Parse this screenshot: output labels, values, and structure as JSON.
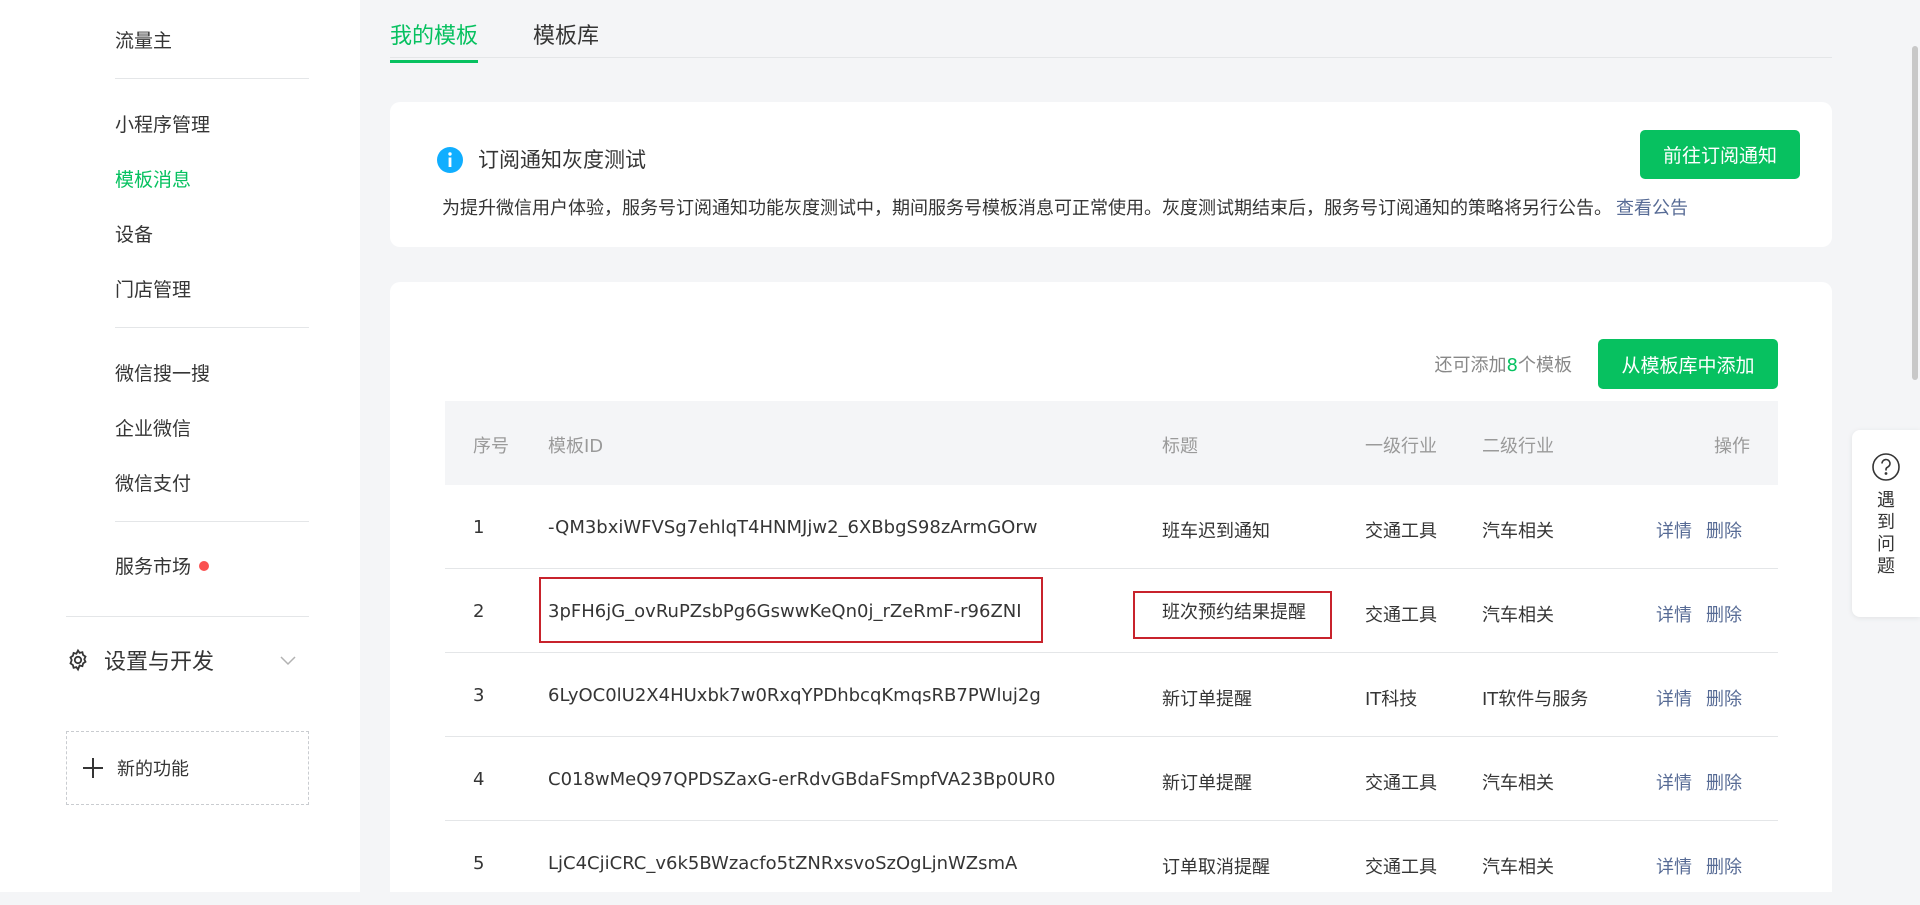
{
  "sidebar": {
    "items": [
      {
        "label": "流量主",
        "active": false
      },
      {
        "label": "小程序管理",
        "active": false
      },
      {
        "label": "模板消息",
        "active": true
      },
      {
        "label": "设备",
        "active": false
      },
      {
        "label": "门店管理",
        "active": false
      },
      {
        "label": "微信搜一搜",
        "active": false
      },
      {
        "label": "企业微信",
        "active": false
      },
      {
        "label": "微信支付",
        "active": false
      },
      {
        "label": "服务市场",
        "active": false
      }
    ],
    "settings_label": "设置与开发",
    "new_feature_label": "新的功能"
  },
  "tabs": [
    {
      "label": "我的模板",
      "active": true
    },
    {
      "label": "模板库",
      "active": false
    }
  ],
  "notice": {
    "title": "订阅通知灰度测试",
    "description": "为提升微信用户体验，服务号订阅通知功能灰度测试中，期间服务号模板消息可正常使用。灰度测试期结束后，服务号订阅通知的策略将另行公告。",
    "link": "查看公告",
    "button": "前往订阅通知"
  },
  "panel": {
    "quota_prefix": "还可添加",
    "quota_count": "8",
    "quota_suffix": "个模板",
    "add_button": "从模板库中添加"
  },
  "table": {
    "headers": {
      "seq": "序号",
      "id": "模板ID",
      "title": "标题",
      "industry1": "一级行业",
      "industry2": "二级行业",
      "ops": "操作"
    },
    "rows": [
      {
        "seq": "1",
        "id": "-QM3bxiWFVSg7ehlqT4HNMJjw2_6XBbgS98zArmGOrw",
        "title": "班车迟到通知",
        "industry1": "交通工具",
        "industry2": "汽车相关"
      },
      {
        "seq": "2",
        "id": "3pFH6jG_ovRuPZsbPg6GswwKeQn0j_rZeRmF-r96ZNI",
        "title": "班次预约结果提醒",
        "industry1": "交通工具",
        "industry2": "汽车相关"
      },
      {
        "seq": "3",
        "id": "6LyOC0lU2X4HUxbk7w0RxqYPDhbcqKmqsRB7PWluj2g",
        "title": "新订单提醒",
        "industry1": "IT科技",
        "industry2": "IT软件与服务"
      },
      {
        "seq": "4",
        "id": "C018wMeQ97QPDSZaxG-erRdvGBdaFSmpfVA23Bp0UR0",
        "title": "新订单提醒",
        "industry1": "交通工具",
        "industry2": "汽车相关"
      },
      {
        "seq": "5",
        "id": "LjC4CjiCRC_v6k5BWzacfo5tZNRxsvoSzOgLjnWZsmA",
        "title": "订单取消提醒",
        "industry1": "交通工具",
        "industry2": "汽车相关"
      }
    ],
    "detail_label": "详情",
    "delete_label": "删除"
  },
  "help": {
    "label": "遇到问题"
  },
  "colors": {
    "accent": "#07c160",
    "link": "#576b95",
    "highlight": "#c8232c",
    "badge": "#fa5151"
  }
}
